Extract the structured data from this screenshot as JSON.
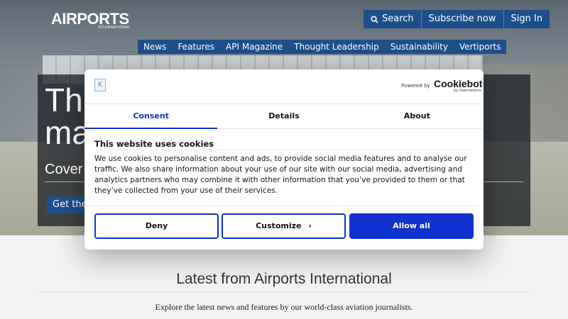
{
  "header": {
    "logo_text": "AIRPORTS",
    "logo_sub": "INTERNATIONAL",
    "top_nav": [
      {
        "label": "Search",
        "icon": "search-icon"
      },
      {
        "label": "Subscribe now"
      },
      {
        "label": "Sign In"
      }
    ],
    "main_nav": [
      "News",
      "Features",
      "API Magazine",
      "Thought Leadership",
      "Sustainability",
      "Vertiports"
    ]
  },
  "hero": {
    "title": "Th\nma",
    "subtitle": "Cover",
    "button": "Get the"
  },
  "latest": {
    "title": "Latest from Airports International",
    "subtitle": "Explore the latest news and features by our world-class aviation journalists."
  },
  "consent": {
    "powered_by": "Powered by",
    "brand": "Cookiebot",
    "brand_sub": "by Usercentrics",
    "tabs": [
      "Consent",
      "Details",
      "About"
    ],
    "active_tab": 0,
    "heading": "This website uses cookies",
    "body": "We use cookies to personalise content and ads, to provide social media features and to analyse our traffic. We also share information about your use of our site with our social media, advertising and analytics partners who may combine it with other information that you’ve provided to them or that they’ve collected from your use of their services.",
    "buttons": {
      "deny": "Deny",
      "customize": "Customize",
      "allow": "Allow all"
    },
    "accent": "#1032cf"
  }
}
